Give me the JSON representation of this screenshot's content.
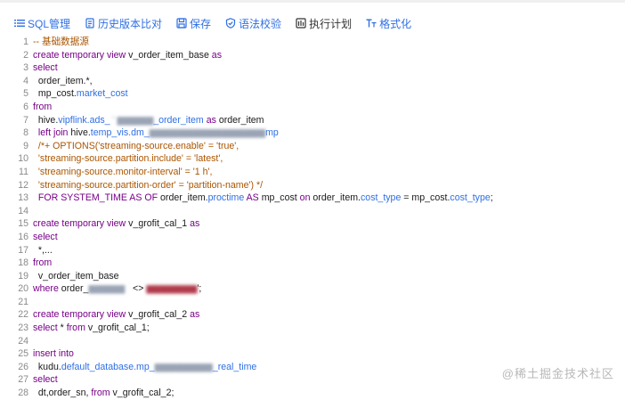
{
  "toolbar": {
    "sql_manage": "SQL管理",
    "history_compare": "历史版本比对",
    "save": "保存",
    "syntax_check": "语法校验",
    "exec_plan": "执行计划",
    "format": "格式化",
    "accent_color": "#2f6fe4"
  },
  "icons": [
    "list-icon",
    "document-compare-icon",
    "save-icon",
    "shield-check-icon",
    "plan-icon",
    "format-text-icon"
  ],
  "line_numbers": [
    "1",
    "2",
    "3",
    "4",
    "5",
    "6",
    "7",
    "8",
    "9",
    "10",
    "11",
    "12",
    "13",
    "14",
    "15",
    "16",
    "17",
    "18",
    "19",
    "20",
    "21",
    "22",
    "23",
    "24",
    "25",
    "26",
    "27",
    "28"
  ],
  "code": {
    "l1": "-- 基础数据源",
    "l2_kw": "create temporary view",
    "l2_name": " v_order_item_base ",
    "l2_as": "as",
    "l3": "select",
    "l4": "  order_item.*,",
    "l5_a": "  mp_cost.",
    "l5_b": "market_cost",
    "l6": "from",
    "l7_a": "  hive.",
    "l7_b": "vipflink.ads_",
    "l7_blur": " ' ",
    "l7_c": "_order_item",
    "l7_as": " as ",
    "l7_d": "order_item",
    "l8_kw": "  left join",
    "l8_a": " hive.",
    "l8_b": "temp_vis.dm_",
    "l8_c": "mp",
    "l9": "  /*+ OPTIONS('streaming-source.enable' = 'true',",
    "l10": "  'streaming-source.partition.include' = 'latest',",
    "l11": "  'streaming-source.monitor-interval' = '1 h',",
    "l12": "  'streaming-source.partition-order' = 'partition-name') */",
    "l13_kw": "  FOR SYSTEM_TIME AS OF",
    "l13_a": " order_item.",
    "l13_b": "proctime",
    "l13_as": " AS ",
    "l13_c": "mp_cost ",
    "l13_on": "on",
    "l13_d": " order_item.",
    "l13_e": "cost_type",
    "l13_f": " = mp_cost.",
    "l13_g": "cost_type",
    "l13_h": ";",
    "l15_kw": "create temporary view",
    "l15_name": " v_grofit_cal_1 ",
    "l15_as": "as",
    "l16": "select",
    "l17": "  *,...",
    "l18": "from",
    "l19": "  v_order_item_base",
    "l20_kw": "where",
    "l20_a": " order_",
    "l20_op": "   <> ",
    "l20_semi": "';",
    "l22_kw": "create temporary view",
    "l22_name": " v_grofit_cal_2 ",
    "l22_as": "as",
    "l23_kw": "select",
    "l23_a": " * ",
    "l23_from": "from",
    "l23_b": " v_grofit_cal_1;",
    "l25": "insert into",
    "l26_a": "  kudu.",
    "l26_b": "default_database.mp_",
    "l26_c": "_real_time",
    "l27": "select",
    "l28_a": "  dt,order_sn, ",
    "l28_from": "from",
    "l28_b": " v_grofit_cal_2;"
  },
  "watermark": "@稀土掘金技术社区"
}
